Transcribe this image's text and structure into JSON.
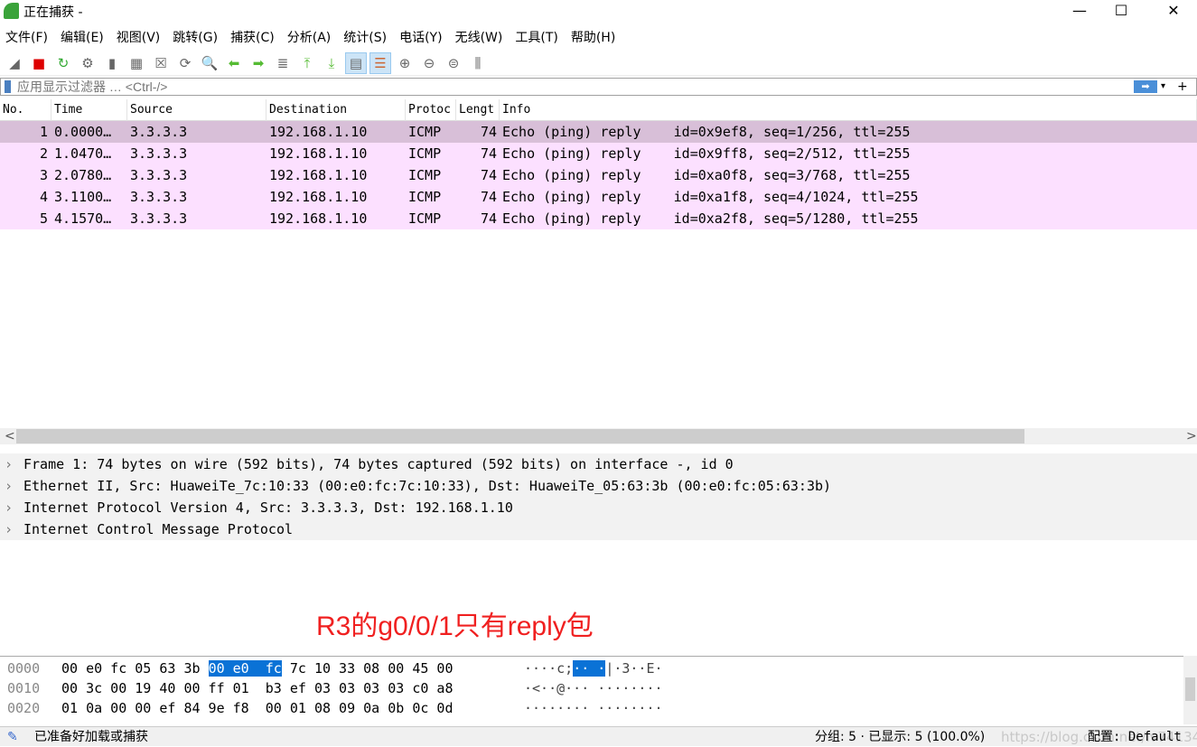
{
  "window": {
    "title": "正在捕获 -"
  },
  "menu": [
    "文件(F)",
    "编辑(E)",
    "视图(V)",
    "跳转(G)",
    "捕获(C)",
    "分析(A)",
    "统计(S)",
    "电话(Y)",
    "无线(W)",
    "工具(T)",
    "帮助(H)"
  ],
  "toolbar": [
    "start-capture",
    "stop-capture",
    "restart-capture",
    "capture-options",
    "open-file",
    "save-file",
    "close-file",
    "reload-file",
    "find-packet",
    "go-back",
    "go-forward",
    "go-to-packet",
    "first-packet",
    "last-packet",
    "auto-scroll",
    "colorize",
    "zoom-in",
    "zoom-out",
    "zoom-normal",
    "resize-columns"
  ],
  "filter": {
    "placeholder": "应用显示过滤器 … <Ctrl-/>"
  },
  "packet_list": {
    "columns": [
      "No.",
      "Time",
      "Source",
      "Destination",
      "Protoc",
      "Lengt",
      "Info"
    ],
    "rows": [
      [
        "1",
        "0.0000…",
        "3.3.3.3",
        "192.168.1.10",
        "ICMP",
        "74",
        "Echo (ping) reply    id=0x9ef8, seq=1/256, ttl=255"
      ],
      [
        "2",
        "1.0470…",
        "3.3.3.3",
        "192.168.1.10",
        "ICMP",
        "74",
        "Echo (ping) reply    id=0x9ff8, seq=2/512, ttl=255"
      ],
      [
        "3",
        "2.0780…",
        "3.3.3.3",
        "192.168.1.10",
        "ICMP",
        "74",
        "Echo (ping) reply    id=0xa0f8, seq=3/768, ttl=255"
      ],
      [
        "4",
        "3.1100…",
        "3.3.3.3",
        "192.168.1.10",
        "ICMP",
        "74",
        "Echo (ping) reply    id=0xa1f8, seq=4/1024, ttl=255"
      ],
      [
        "5",
        "4.1570…",
        "3.3.3.3",
        "192.168.1.10",
        "ICMP",
        "74",
        "Echo (ping) reply    id=0xa2f8, seq=5/1280, ttl=255"
      ]
    ],
    "selected_row": 1
  },
  "details": [
    "Frame 1: 74 bytes on wire (592 bits), 74 bytes captured (592 bits) on interface -, id 0",
    "Ethernet II, Src: HuaweiTe_7c:10:33 (00:e0:fc:7c:10:33), Dst: HuaweiTe_05:63:3b (00:e0:fc:05:63:3b)",
    "Internet Protocol Version 4, Src: 3.3.3.3, Dst: 192.168.1.10",
    "Internet Control Message Protocol"
  ],
  "annotation": "R3的g0/0/1只有reply包",
  "bytes": [
    {
      "offset": "0000",
      "hex_a": "00 e0 fc 05 63 3b ",
      "hex_hl": "00 e0  fc",
      "hex_b": " 7c 10 33 08 00 45 00",
      "ascii_a": "····c;",
      "ascii_hl": "·· ·",
      "ascii_b": "|·3··E·"
    },
    {
      "offset": "0010",
      "hex_a": "00 3c 00 19 40 00 ff 01  b3 ef 03 03 03 03 c0 a8",
      "hex_hl": "",
      "hex_b": "",
      "ascii_a": "·<··@··· ········",
      "ascii_hl": "",
      "ascii_b": ""
    },
    {
      "offset": "0020",
      "hex_a": "01 0a 00 00 ef 84 9e f8  00 01 08 09 0a 0b 0c 0d",
      "hex_hl": "",
      "hex_b": "",
      "ascii_a": "········ ········",
      "ascii_hl": "",
      "ascii_b": ""
    }
  ],
  "status": {
    "left": "已准备好加载或捕获",
    "packets": "分组: 5 · 已显示: 5 (100.0%)",
    "profile": "配置: Default",
    "watermark": "https://blog.csdn.net/lv74134"
  },
  "colors": {
    "row": "#fce0ff",
    "selected_row": "#d8bfd8",
    "highlight": "#0a72d6",
    "annotation": "#f02020"
  }
}
